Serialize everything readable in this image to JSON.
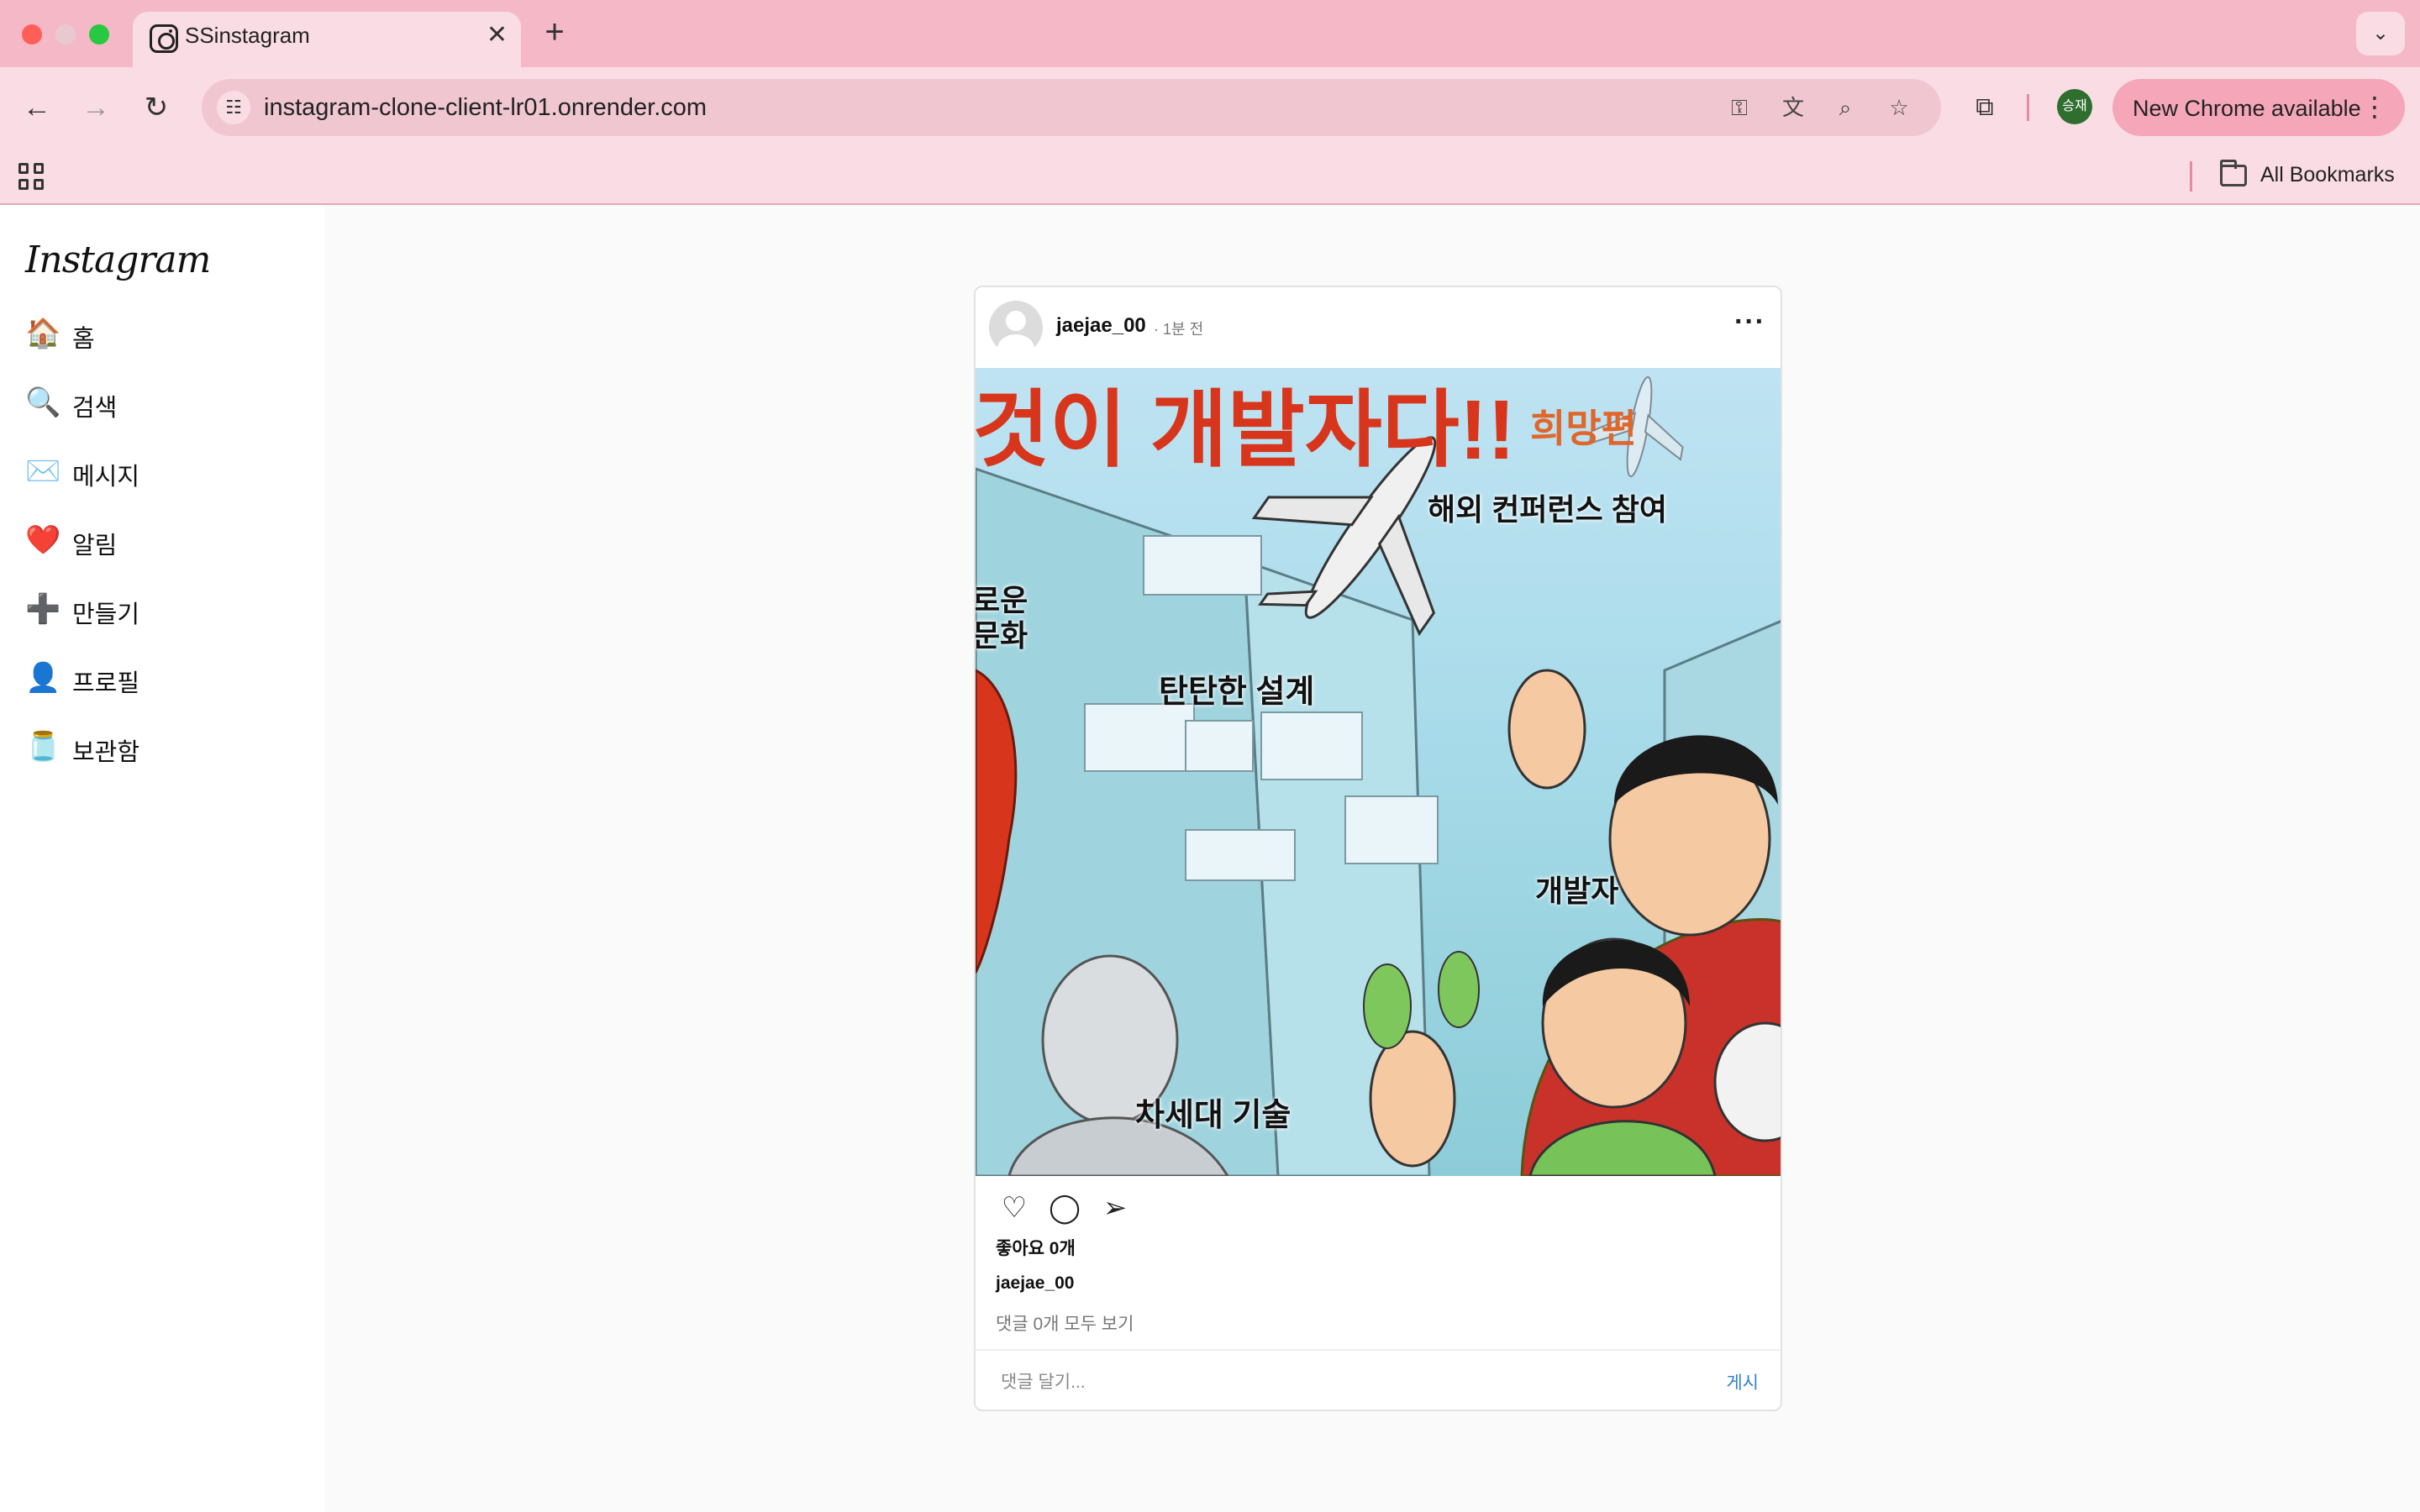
{
  "browser": {
    "tab_title": "SSinstagram",
    "tab_close": "✕",
    "new_tab": "+",
    "tab_menu": "⌄",
    "url": "instagram-clone-client-lr01.onrender.com",
    "profile_initials": "승재",
    "update_label": "New Chrome available",
    "bookmarks_label": "All Bookmarks"
  },
  "sidebar": {
    "logo": "Instagram",
    "items": [
      {
        "icon": "🏠",
        "label": "홈"
      },
      {
        "icon": "🔍",
        "label": "검색"
      },
      {
        "icon": "✉️",
        "label": "메시지"
      },
      {
        "icon": "❤️",
        "label": "알림"
      },
      {
        "icon": "➕",
        "label": "만들기"
      },
      {
        "icon": "👤",
        "label": "프로필"
      },
      {
        "icon": "🫙",
        "label": "보관함"
      }
    ]
  },
  "post": {
    "username": "jaejae_00",
    "time": "· 1분 전",
    "image_text": {
      "headline": "것이 개발자다!!",
      "headline_sub": "희망편",
      "conference": "해외 컨퍼런스 참여",
      "culture_1": "로운",
      "culture_2": "문화",
      "design": "탄탄한 설계",
      "developer": "개발자",
      "next_tech": "차세대 기술"
    },
    "likes": "좋아요 0개",
    "caption_user": "jaejae_00",
    "comments_link": "댓글 0개 모두 보기",
    "comment_placeholder": "댓글 달기...",
    "post_button": "게시"
  },
  "colors": {
    "chrome_bg": "#f5b8c6",
    "toolbar_bg": "#fadde4",
    "accent_blue": "#2f7fd6",
    "headline_red": "#d8361c"
  }
}
